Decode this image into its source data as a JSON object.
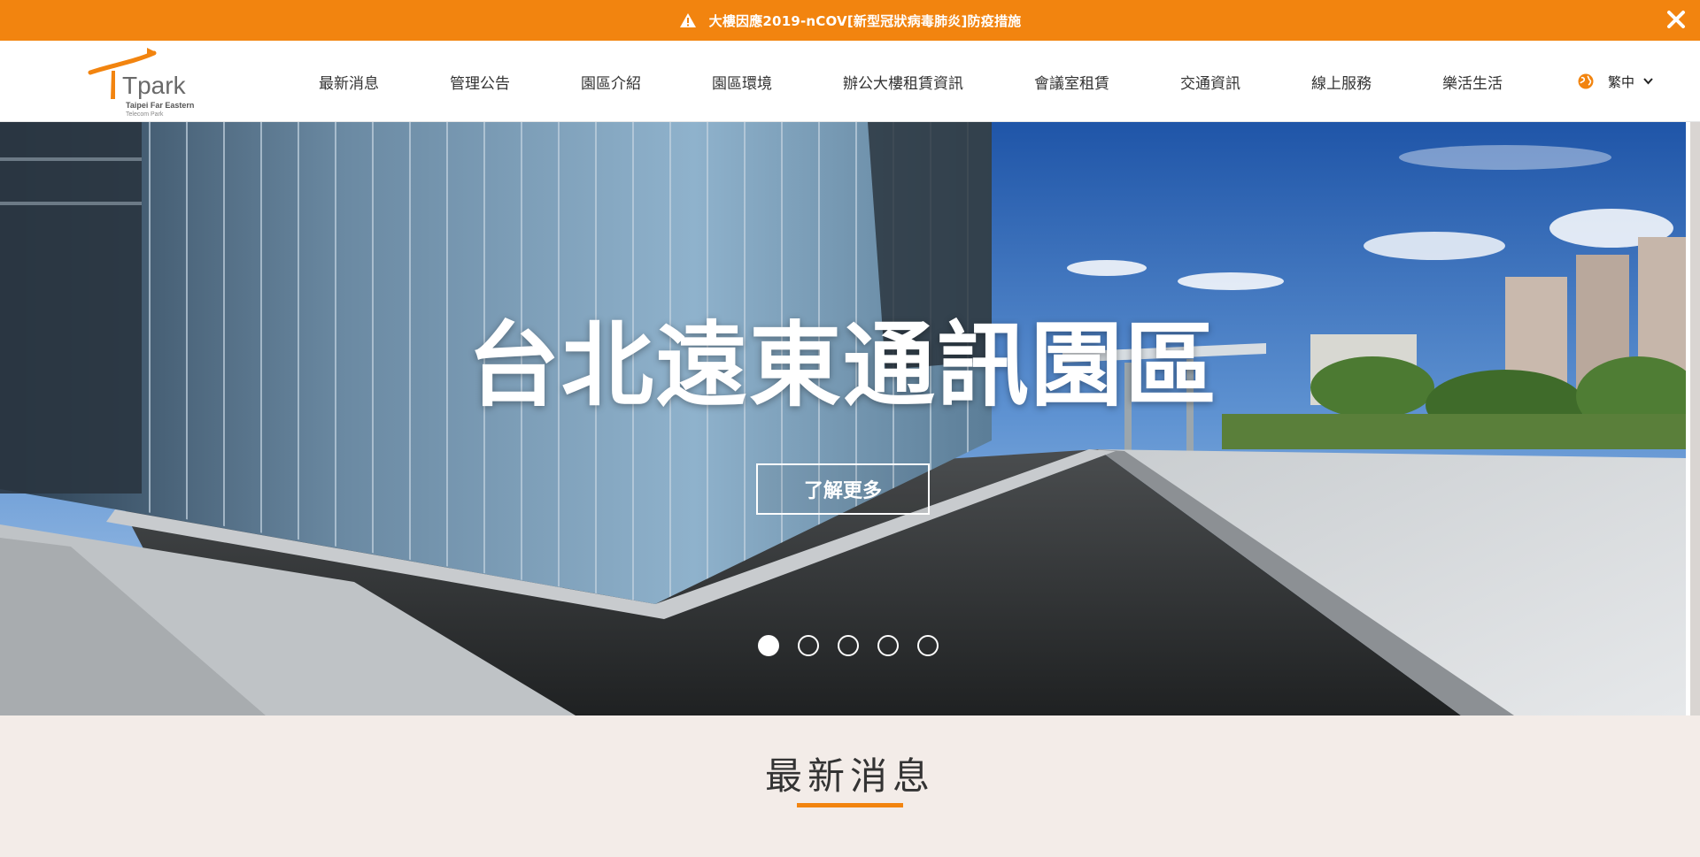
{
  "alert": {
    "text": "大樓因應2019-nCOV[新型冠狀病毒肺炎]防疫措施",
    "icon": "warning-icon",
    "close_icon": "close-icon"
  },
  "header": {
    "logo_text": "Tpark",
    "logo_sub1": "Taipei Far Eastern",
    "logo_sub2": "Telecom Park",
    "nav": [
      {
        "label": "最新消息"
      },
      {
        "label": "管理公告"
      },
      {
        "label": "園區介紹"
      },
      {
        "label": "園區環境"
      },
      {
        "label": "辦公大樓租賃資訊"
      },
      {
        "label": "會議室租賃"
      },
      {
        "label": "交通資訊"
      },
      {
        "label": "線上服務"
      },
      {
        "label": "樂活生活"
      }
    ],
    "language": {
      "label": "繁中",
      "icon": "globe-icon"
    }
  },
  "hero": {
    "title": "台北遠東通訊園區",
    "button_label": "了解更多",
    "slide_count": 5,
    "active_slide": 1
  },
  "news": {
    "title": "最新消息"
  },
  "colors": {
    "accent": "#f2840f",
    "section_bg": "#f3ece8",
    "header_bg": "#ffffff"
  }
}
